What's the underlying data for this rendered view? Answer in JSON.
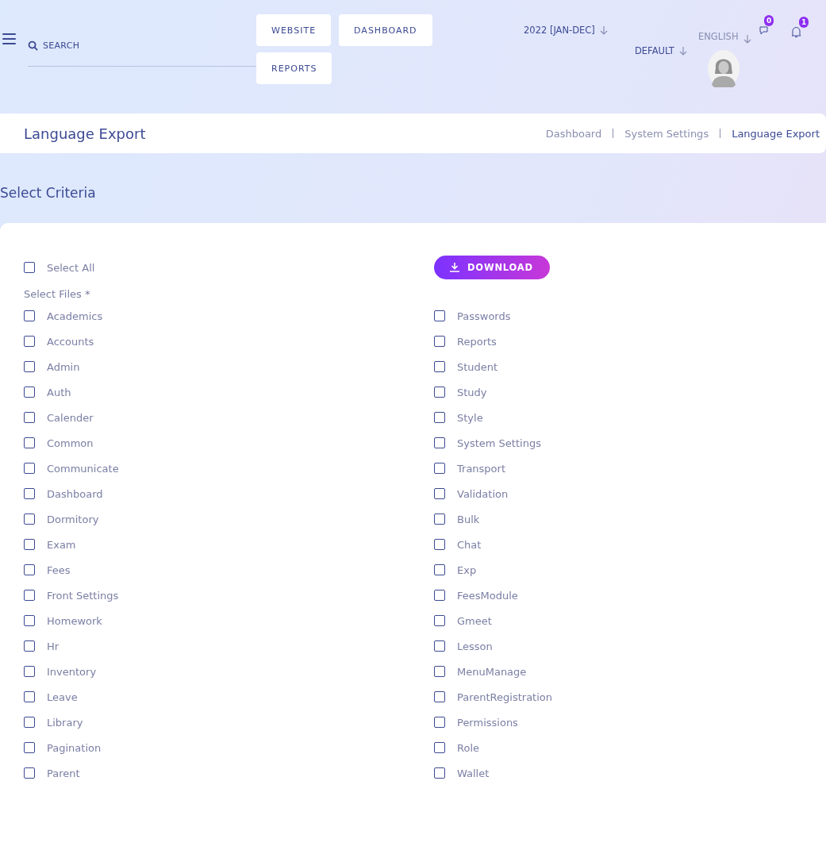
{
  "header": {
    "search": {
      "placeholder": "SEARCH"
    },
    "nav_buttons": [
      "WEBSITE",
      "DASHBOARD",
      "REPORTS"
    ],
    "session": "2022 [JAN-DEC]",
    "language": "ENGLISH",
    "style": "DEFAULT",
    "messages_badge": "0",
    "notifications_badge": "1"
  },
  "page_title": "Language Export",
  "breadcrumb": [
    {
      "label": "Dashboard",
      "selected": false
    },
    {
      "label": "System Settings",
      "selected": false
    },
    {
      "label": "Language Export",
      "selected": true
    }
  ],
  "section_title": "Select Criteria",
  "select_all": {
    "label": "Select All",
    "checked": false
  },
  "download_button": "DOWNLOAD",
  "files_label": "Select Files *",
  "files": [
    {
      "label": "Academics",
      "checked": false
    },
    {
      "label": "Accounts",
      "checked": false
    },
    {
      "label": "Admin",
      "checked": false
    },
    {
      "label": "Auth",
      "checked": false
    },
    {
      "label": "Calender",
      "checked": false
    },
    {
      "label": "Common",
      "checked": false
    },
    {
      "label": "Communicate",
      "checked": false
    },
    {
      "label": "Dashboard",
      "checked": false
    },
    {
      "label": "Dormitory",
      "checked": false
    },
    {
      "label": "Exam",
      "checked": false
    },
    {
      "label": "Fees",
      "checked": false
    },
    {
      "label": "Front Settings",
      "checked": false
    },
    {
      "label": "Homework",
      "checked": false
    },
    {
      "label": "Hr",
      "checked": false
    },
    {
      "label": "Inventory",
      "checked": false
    },
    {
      "label": "Leave",
      "checked": false
    },
    {
      "label": "Library",
      "checked": false
    },
    {
      "label": "Pagination",
      "checked": false
    },
    {
      "label": "Parent",
      "checked": false
    },
    {
      "label": "Passwords",
      "checked": false
    },
    {
      "label": "Reports",
      "checked": false
    },
    {
      "label": "Student",
      "checked": false
    },
    {
      "label": "Study",
      "checked": false
    },
    {
      "label": "Style",
      "checked": false
    },
    {
      "label": "System Settings",
      "checked": false
    },
    {
      "label": "Transport",
      "checked": false
    },
    {
      "label": "Validation",
      "checked": false
    },
    {
      "label": "Bulk",
      "checked": false
    },
    {
      "label": "Chat",
      "checked": false
    },
    {
      "label": "Exp",
      "checked": false
    },
    {
      "label": "FeesModule",
      "checked": false
    },
    {
      "label": "Gmeet",
      "checked": false
    },
    {
      "label": "Lesson",
      "checked": false
    },
    {
      "label": "MenuManage",
      "checked": false
    },
    {
      "label": "ParentRegistration",
      "checked": false
    },
    {
      "label": "Permissions",
      "checked": false
    },
    {
      "label": "Role",
      "checked": false
    },
    {
      "label": "Wallet",
      "checked": false
    }
  ]
}
